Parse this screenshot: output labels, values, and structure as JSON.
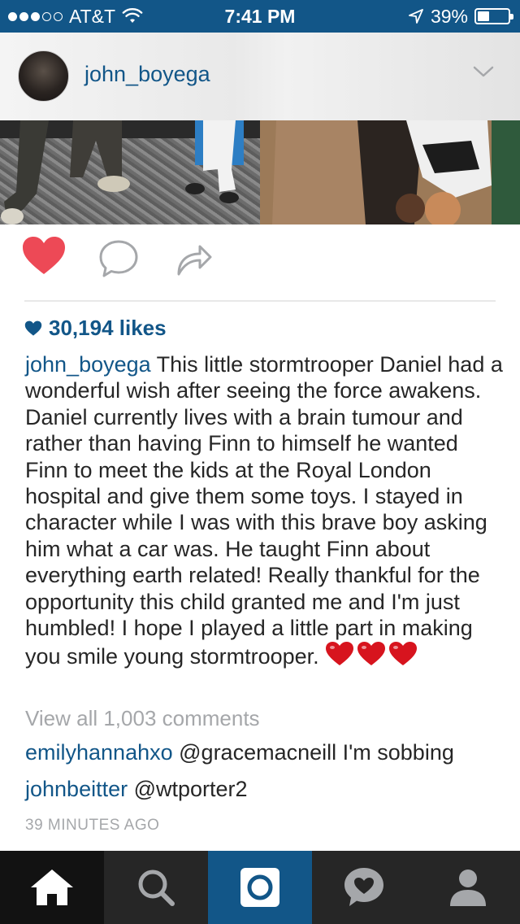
{
  "status_bar": {
    "carrier": "AT&T",
    "time": "7:41 PM",
    "battery": "39%",
    "battery_level": 0.39,
    "signal_bars": 3,
    "signal_total": 5
  },
  "post": {
    "username": "john_boyega",
    "likes": "30,194 likes",
    "liked": true,
    "caption_user": "john_boyega",
    "caption_text": "This little stormtrooper Daniel had a wonderful wish after seeing the force awakens. Daniel currently lives with a brain tumour and rather than having Finn to himself he wanted Finn to meet the kids at the Royal London hospital and give them some toys. I stayed in character while I was with this brave boy asking him what a car was. He taught Finn about everything earth related! Really thankful for the opportunity this child granted me and I'm just humbled! I hope I played a little part in making you smile young stormtrooper.",
    "view_all_comments": "View all 1,003 comments",
    "comments": [
      {
        "user": "emilyhannahxo",
        "text": "@gracemacneill I'm sobbing"
      },
      {
        "user": "johnbeitter",
        "text": "@wtporter2"
      }
    ],
    "timestamp": "39 MINUTES AGO"
  },
  "tabs": [
    {
      "name": "home",
      "icon": "home-icon"
    },
    {
      "name": "search",
      "icon": "search-icon"
    },
    {
      "name": "camera",
      "icon": "camera-icon"
    },
    {
      "name": "activity",
      "icon": "activity-heart-icon"
    },
    {
      "name": "profile",
      "icon": "profile-icon"
    }
  ],
  "colors": {
    "brand_blue": "#125688",
    "like_red": "#ed4956",
    "muted_gray": "#a5a7aa",
    "tab_bar": "#262626"
  }
}
